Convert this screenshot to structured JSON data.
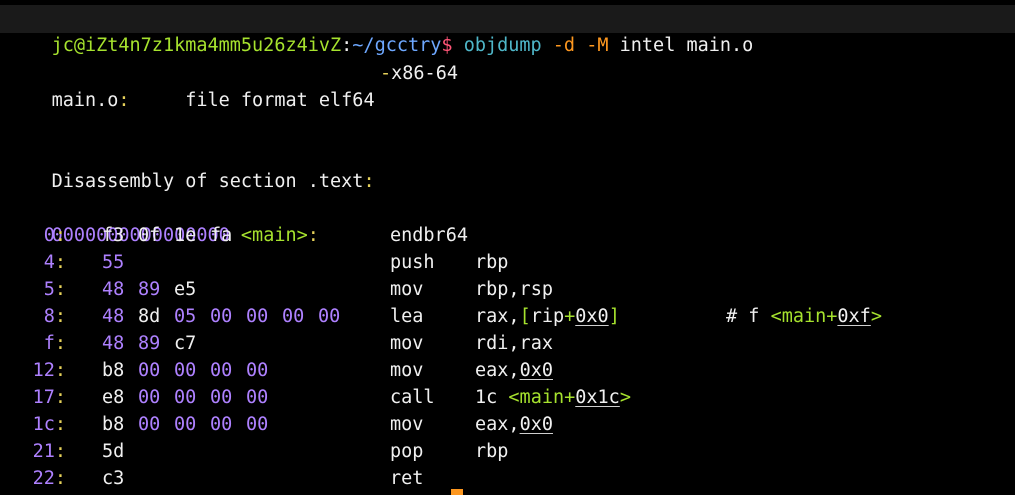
{
  "prompt": {
    "user_host": "jc@iZt4n7z1kma4mm5u26z4ivZ",
    "sep": ":",
    "path": "~/gcctry",
    "symbol": "$",
    "cmd": "objdump",
    "flag1": "-d",
    "flag2": "-M",
    "arg1": "intel",
    "arg2": "main.o"
  },
  "header": {
    "file": "main.o",
    "colon": ":",
    "format_label": "file format elf64",
    "dash": "-",
    "format_arch": "x86-64",
    "disasm_label": "Disassembly of section .text",
    "disasm_colon": ":"
  },
  "symbol_line": {
    "address": "0000000000000000",
    "label": "<main>",
    "colon": ":"
  },
  "rows": [
    {
      "addr": "0:",
      "b0": "f3",
      "b1": "0f",
      "b2": "1e",
      "b3": "fa",
      "b4": "",
      "b5": "",
      "b6": "",
      "mnemonic": "endbr64",
      "operand": ""
    },
    {
      "addr": "4:",
      "b0": "55",
      "b1": "",
      "b2": "",
      "b3": "",
      "b4": "",
      "b5": "",
      "b6": "",
      "mnemonic": "push",
      "operand": "rbp"
    },
    {
      "addr": "5:",
      "b0": "48",
      "b1": "89",
      "b2": "e5",
      "b3": "",
      "b4": "",
      "b5": "",
      "b6": "",
      "mnemonic": "mov",
      "operand": "rbp,rsp"
    },
    {
      "addr": "8:",
      "b0": "48",
      "b1": "8d",
      "b2": "05",
      "b3": "00",
      "b4": "00",
      "b5": "00",
      "b6": "00",
      "mnemonic": "lea",
      "operand": "rax,[rip+0x0]",
      "comment": "# f <main+0xf>"
    },
    {
      "addr": "f:",
      "b0": "48",
      "b1": "89",
      "b2": "c7",
      "b3": "",
      "b4": "",
      "b5": "",
      "b6": "",
      "mnemonic": "mov",
      "operand": "rdi,rax"
    },
    {
      "addr": "12:",
      "b0": "b8",
      "b1": "00",
      "b2": "00",
      "b3": "00",
      "b4": "00",
      "b5": "",
      "b6": "",
      "mnemonic": "mov",
      "operand": "eax,0x0"
    },
    {
      "addr": "17:",
      "b0": "e8",
      "b1": "00",
      "b2": "00",
      "b3": "00",
      "b4": "00",
      "b5": "",
      "b6": "",
      "mnemonic": "call",
      "operand": "1c <main+0x1c>"
    },
    {
      "addr": "1c:",
      "b0": "b8",
      "b1": "00",
      "b2": "00",
      "b3": "00",
      "b4": "00",
      "b5": "",
      "b6": "",
      "mnemonic": "mov",
      "operand": "eax,0x0"
    },
    {
      "addr": "21:",
      "b0": "5d",
      "b1": "",
      "b2": "",
      "b3": "",
      "b4": "",
      "b5": "",
      "b6": "",
      "mnemonic": "pop",
      "operand": "rbp"
    },
    {
      "addr": "22:",
      "b0": "c3",
      "b1": "",
      "b2": "",
      "b3": "",
      "b4": "",
      "b5": "",
      "b6": "",
      "mnemonic": "ret",
      "operand": ""
    }
  ],
  "row_parts": {
    "lea_op_a": "rax,",
    "lea_op_b": "[",
    "lea_op_c": "rip",
    "lea_op_d": "+",
    "lea_op_e": "0x0",
    "lea_op_f": "]",
    "lea_comment_hash": "# f ",
    "lea_comment_lt": "<main",
    "lea_comment_plus": "+",
    "lea_comment_hex": "0xf",
    "lea_comment_gt": ">",
    "mov_eax_a": "eax,",
    "mov_eax_b": "0x0",
    "call_a": "1c ",
    "call_b": "<main",
    "call_c": "+",
    "call_d": "0x1c",
    "call_e": ">"
  },
  "colors": {
    "background": "#000000",
    "prompt_green": "#a6e22e",
    "path_blue": "#6ea8ff",
    "dollar_pink": "#ff5577",
    "cmd_cyan": "#4fb7c9",
    "flag_orange": "#fd971f",
    "colon_yellow": "#e6d15a",
    "number_purple": "#ae81ff",
    "text": "#f0f0f0"
  }
}
